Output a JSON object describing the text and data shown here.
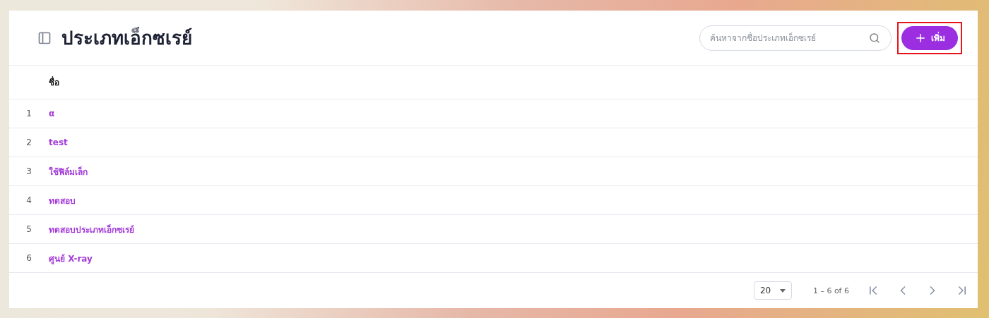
{
  "page": {
    "title": "ประเภทเอ็กซเรย์"
  },
  "search": {
    "placeholder": "ค้นหาจากชื่อประเภทเอ็กซเรย์"
  },
  "add_button": {
    "label": "เพิ่ม",
    "highlighted": true
  },
  "table": {
    "columns": [
      "ชื่อ"
    ],
    "rows": [
      {
        "index": "1",
        "name": "α"
      },
      {
        "index": "2",
        "name": "test"
      },
      {
        "index": "3",
        "name": "ใช้ฟิล์มเล็ก"
      },
      {
        "index": "4",
        "name": "ทดสอบ"
      },
      {
        "index": "5",
        "name": "ทดสอบประเภทเอ็กซเรย์"
      },
      {
        "index": "6",
        "name": "ศูนย์ X-ray"
      }
    ]
  },
  "pagination": {
    "page_size": "20",
    "range": "1 – 6 of 6"
  }
}
